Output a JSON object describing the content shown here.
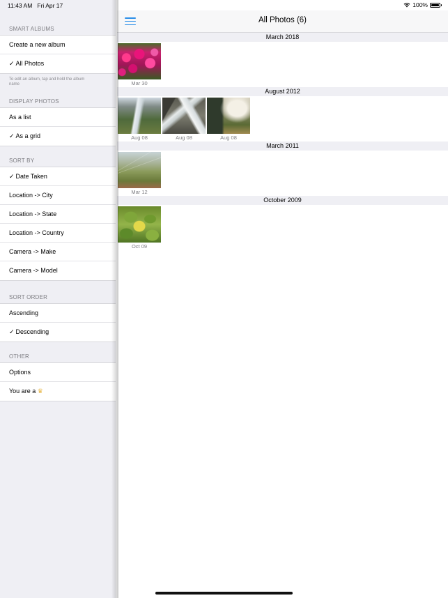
{
  "status_bar": {
    "time": "11:43 AM",
    "date": "Fri Apr 17",
    "battery": "100%",
    "icons": [
      "wifi-icon",
      "battery-icon"
    ]
  },
  "sidebar": {
    "smart_albums": {
      "header": "SMART ALBUMS",
      "items": [
        {
          "label": "Create a new album",
          "checked": false
        },
        {
          "label": "All Photos",
          "checked": true
        }
      ],
      "footnote": "To edit an album, tap and hold the album name"
    },
    "display_photos": {
      "header": "DISPLAY PHOTOS",
      "items": [
        {
          "label": "As a list",
          "checked": false
        },
        {
          "label": "As a grid",
          "checked": true
        }
      ]
    },
    "sort_by": {
      "header": "SORT BY",
      "items": [
        {
          "label": "Date Taken",
          "checked": true
        },
        {
          "label": "Location -> City",
          "checked": false
        },
        {
          "label": "Location -> State",
          "checked": false
        },
        {
          "label": "Location -> Country",
          "checked": false
        },
        {
          "label": "Camera -> Make",
          "checked": false
        },
        {
          "label": "Camera -> Model",
          "checked": false
        }
      ]
    },
    "sort_order": {
      "header": "SORT ORDER",
      "items": [
        {
          "label": "Ascending",
          "checked": false
        },
        {
          "label": "Descending",
          "checked": true
        }
      ]
    },
    "other": {
      "header": "OTHER",
      "items": [
        {
          "label": "Options"
        },
        {
          "label": "You are a",
          "icon": "crown-icon"
        }
      ]
    },
    "checkmark": "✓"
  },
  "main": {
    "title": "All Photos (6)",
    "sections": [
      {
        "month": "March 2018",
        "photos": [
          {
            "label": "Mar 30"
          }
        ]
      },
      {
        "month": "August 2012",
        "photos": [
          {
            "label": "Aug 08"
          },
          {
            "label": "Aug 08"
          },
          {
            "label": "Aug 08"
          }
        ]
      },
      {
        "month": "March 2011",
        "photos": [
          {
            "label": "Mar 12"
          }
        ]
      },
      {
        "month": "October 2009",
        "photos": [
          {
            "label": "Oct 09"
          }
        ]
      }
    ]
  },
  "colors": {
    "accent": "#2a8ee8",
    "sidebar_bg": "#efeff4",
    "section_header_text": "#7d7d82"
  }
}
